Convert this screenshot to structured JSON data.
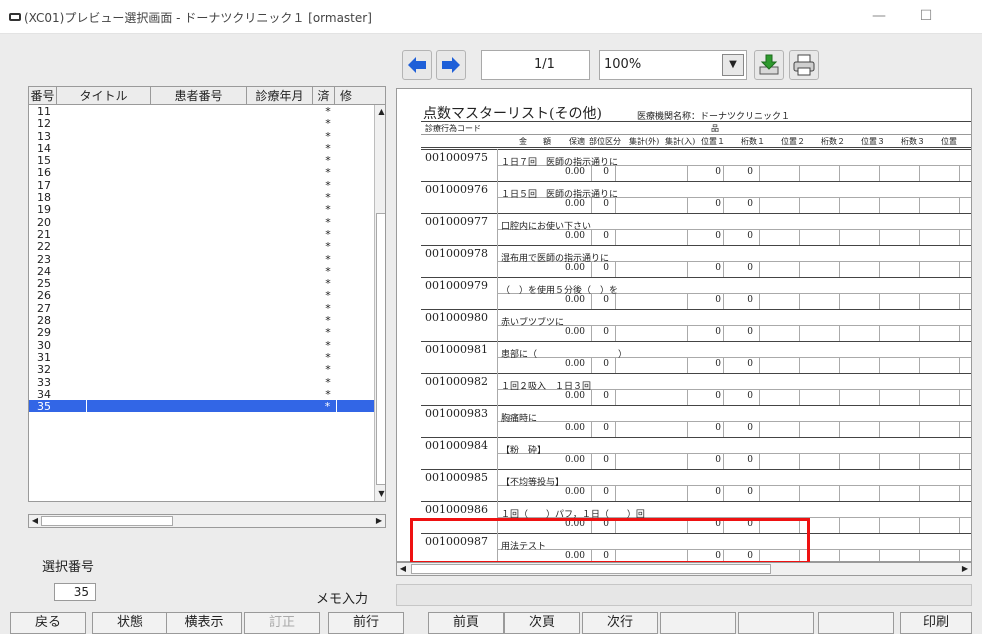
{
  "window": {
    "title": "(XC01)プレビュー選択画面 - ドーナツクリニック１ [ormaster]",
    "minimize_glyph": "—",
    "maximize_glyph": "☐"
  },
  "list": {
    "headers": [
      "番号",
      "タイトル",
      "患者番号",
      "診療年月",
      "済",
      "修"
    ],
    "rows": [
      {
        "no": "11",
        "sumi": "*"
      },
      {
        "no": "12",
        "sumi": "*"
      },
      {
        "no": "13",
        "sumi": "*"
      },
      {
        "no": "14",
        "sumi": "*"
      },
      {
        "no": "15",
        "sumi": "*"
      },
      {
        "no": "16",
        "sumi": "*"
      },
      {
        "no": "17",
        "sumi": "*"
      },
      {
        "no": "18",
        "sumi": "*"
      },
      {
        "no": "19",
        "sumi": "*"
      },
      {
        "no": "20",
        "sumi": "*"
      },
      {
        "no": "21",
        "sumi": "*"
      },
      {
        "no": "22",
        "sumi": "*"
      },
      {
        "no": "23",
        "sumi": "*"
      },
      {
        "no": "24",
        "sumi": "*"
      },
      {
        "no": "25",
        "sumi": "*"
      },
      {
        "no": "26",
        "sumi": "*"
      },
      {
        "no": "27",
        "sumi": "*"
      },
      {
        "no": "28",
        "sumi": "*"
      },
      {
        "no": "29",
        "sumi": "*"
      },
      {
        "no": "30",
        "sumi": "*"
      },
      {
        "no": "31",
        "sumi": "*"
      },
      {
        "no": "32",
        "sumi": "*"
      },
      {
        "no": "33",
        "sumi": "*"
      },
      {
        "no": "34",
        "sumi": "*"
      },
      {
        "no": "35",
        "sumi": "*"
      }
    ],
    "selected_row": "35"
  },
  "selection": {
    "label": "選択番号",
    "value": "35"
  },
  "toolbar": {
    "page": "1/1",
    "zoom": "100%"
  },
  "report": {
    "title": "点数マスターリスト(その他)",
    "facility": "医療機関名称：ドーナツクリニック１",
    "header_row1": {
      "code": "診療行為コード",
      "name": "品"
    },
    "header_row2": [
      "金　　額",
      "保適",
      "部位区分",
      "集計(外)",
      "集計(入)",
      "位置１",
      "桁数１",
      "位置２",
      "桁数２",
      "位置３",
      "桁数３",
      "位置"
    ],
    "records": [
      {
        "code": "001000975",
        "name": "１日７回　医師の指示通りに",
        "amount": "0.00",
        "hok": "0",
        "c1": "0",
        "c2": "0"
      },
      {
        "code": "001000976",
        "name": "１日５回　医師の指示通りに",
        "amount": "0.00",
        "hok": "0",
        "c1": "0",
        "c2": "0"
      },
      {
        "code": "001000977",
        "name": "口腔内にお使い下さい",
        "amount": "0.00",
        "hok": "0",
        "c1": "0",
        "c2": "0"
      },
      {
        "code": "001000978",
        "name": "湿布用で医師の指示通りに",
        "amount": "0.00",
        "hok": "0",
        "c1": "0",
        "c2": "0"
      },
      {
        "code": "001000979",
        "name": "（　）を使用５分後（　）を",
        "amount": "0.00",
        "hok": "0",
        "c1": "0",
        "c2": "0"
      },
      {
        "code": "001000980",
        "name": "赤いブツブツに",
        "amount": "0.00",
        "hok": "0",
        "c1": "0",
        "c2": "0"
      },
      {
        "code": "001000981",
        "name": "患部に（　　　　　　　　　）",
        "amount": "0.00",
        "hok": "0",
        "c1": "0",
        "c2": "0"
      },
      {
        "code": "001000982",
        "name": "１回２吸入　１日３回",
        "amount": "0.00",
        "hok": "0",
        "c1": "0",
        "c2": "0"
      },
      {
        "code": "001000983",
        "name": "胸痛時に",
        "amount": "0.00",
        "hok": "0",
        "c1": "0",
        "c2": "0"
      },
      {
        "code": "001000984",
        "name": "【粉　砕】",
        "amount": "0.00",
        "hok": "0",
        "c1": "0",
        "c2": "0"
      },
      {
        "code": "001000985",
        "name": "【不均等投与】",
        "amount": "0.00",
        "hok": "0",
        "c1": "0",
        "c2": "0"
      },
      {
        "code": "001000986",
        "name": "１回（　　）パフ，１日（　　）回",
        "amount": "0.00",
        "hok": "0",
        "c1": "0",
        "c2": "0"
      },
      {
        "code": "001000987",
        "name": "用法テスト",
        "amount": "0.00",
        "hok": "0",
        "c1": "0",
        "c2": "0"
      }
    ]
  },
  "memo": {
    "label": "メモ入力"
  },
  "buttons": [
    {
      "name": "back-button",
      "label": "戻る",
      "enabled": true
    },
    {
      "name": "status-button",
      "label": "状態",
      "enabled": true
    },
    {
      "name": "landscape-button",
      "label": "横表示",
      "enabled": true
    },
    {
      "name": "correct-button",
      "label": "訂正",
      "enabled": false
    },
    {
      "name": "prev-row-button",
      "label": "前行",
      "enabled": true
    },
    {
      "name": "prev-page-button",
      "label": "前頁",
      "enabled": true
    },
    {
      "name": "next-page-button",
      "label": "次頁",
      "enabled": true
    },
    {
      "name": "next-row-button",
      "label": "次行",
      "enabled": true
    },
    {
      "name": "blank-button-1",
      "label": "",
      "enabled": true
    },
    {
      "name": "blank-button-2",
      "label": "",
      "enabled": true
    },
    {
      "name": "blank-button-3",
      "label": "",
      "enabled": true
    },
    {
      "name": "print-button",
      "label": "印刷",
      "enabled": true
    }
  ],
  "colors": {
    "selection": "#3266e6",
    "highlight_box": "#e11111",
    "arrow_blue": "#1e5fd8",
    "download_green": "#2e9a2e"
  },
  "icons": {
    "app": "app-icon",
    "prev": "arrow-left-icon",
    "next": "arrow-right-icon",
    "download": "download-icon",
    "print": "printer-icon"
  }
}
